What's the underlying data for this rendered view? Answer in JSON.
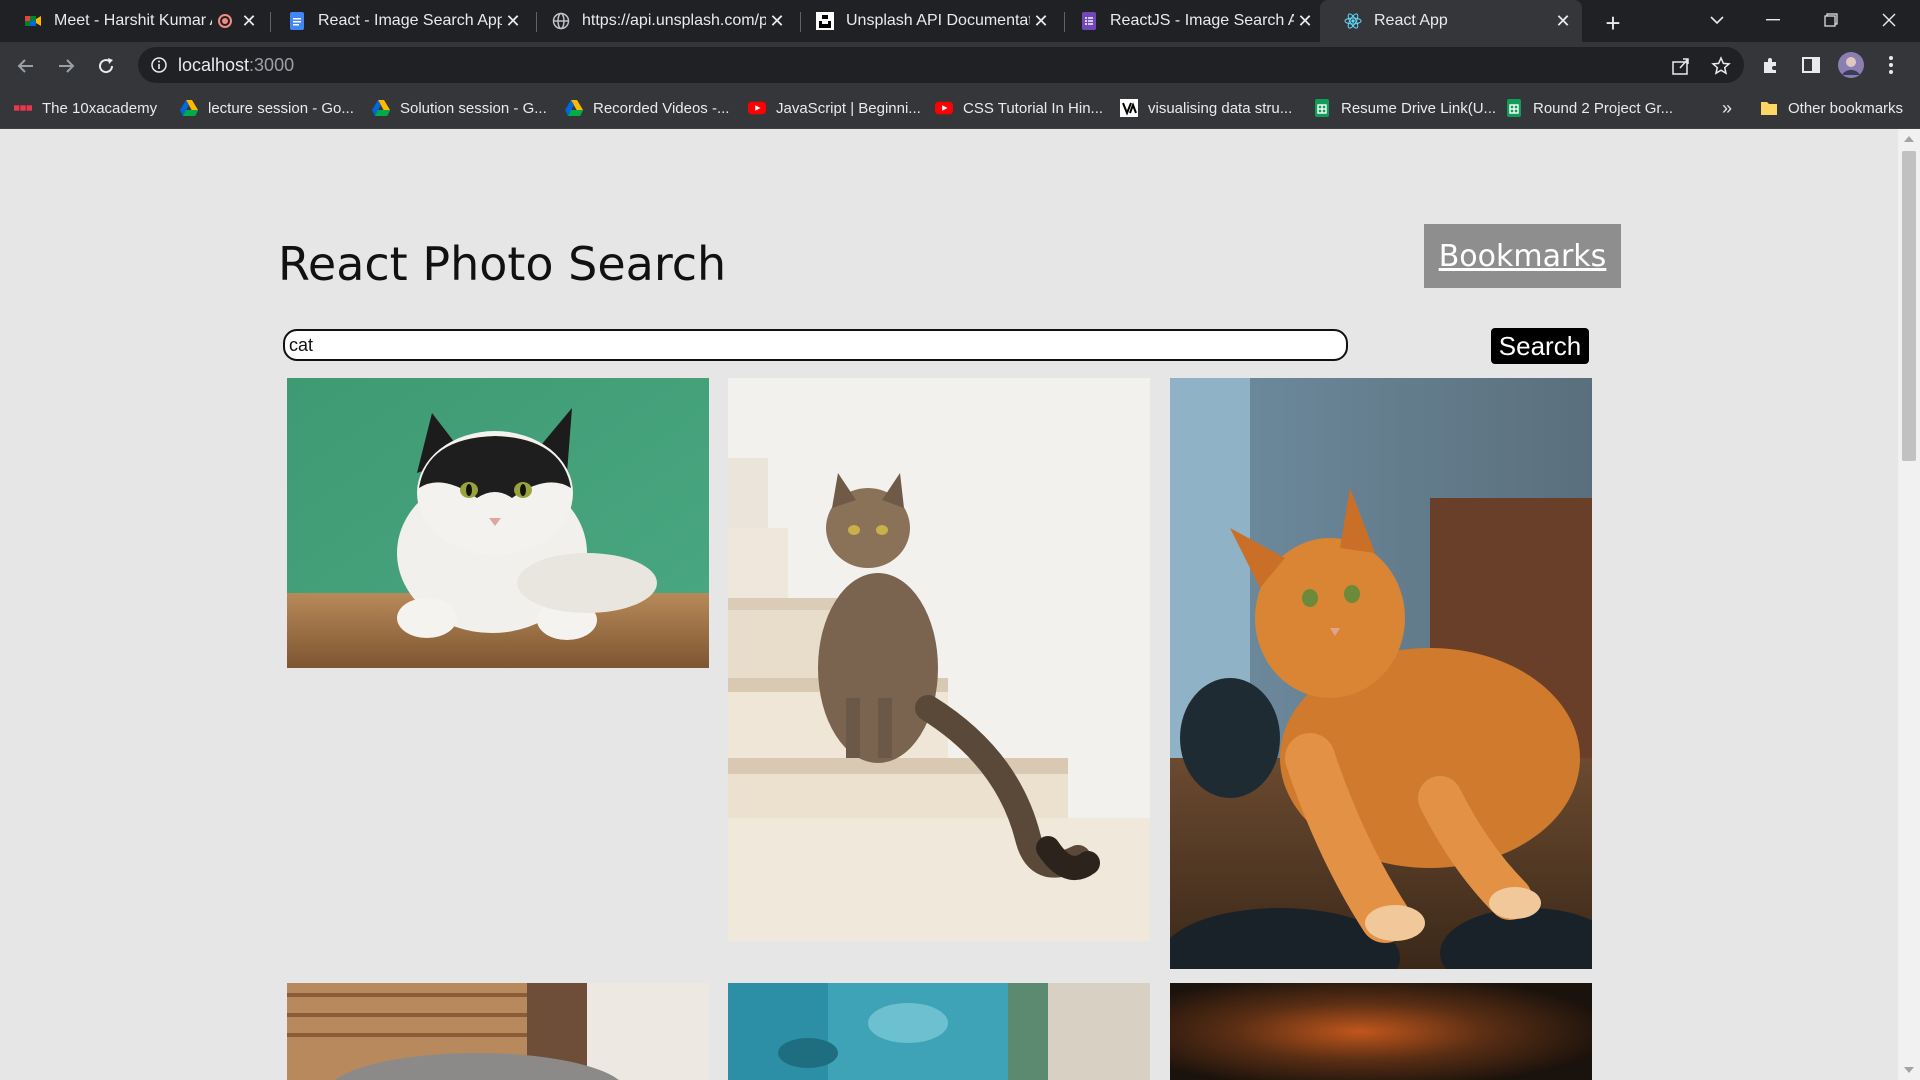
{
  "browser": {
    "tabs": [
      {
        "title": "Meet - Harshit Kumar A",
        "icon": "google-meet-icon",
        "recording": true
      },
      {
        "title": "React - Image Search App -",
        "icon": "google-docs-icon"
      },
      {
        "title": "https://api.unsplash.com/pl",
        "icon": "globe-icon"
      },
      {
        "title": "Unsplash API Documentatio",
        "icon": "unsplash-icon"
      },
      {
        "title": "ReactJS - Image Search App",
        "icon": "google-forms-icon"
      },
      {
        "title": "React App",
        "icon": "react-icon",
        "active": true
      }
    ],
    "address": {
      "host": "localhost",
      "port": ":3000"
    },
    "bookmarks": [
      {
        "label": "The 10xacademy",
        "icon": "academy-icon"
      },
      {
        "label": "lecture session - Go...",
        "icon": "google-drive-icon"
      },
      {
        "label": "Solution session - G...",
        "icon": "google-drive-icon"
      },
      {
        "label": "Recorded Videos -...",
        "icon": "google-drive-icon"
      },
      {
        "label": "JavaScript | Beginni...",
        "icon": "youtube-icon"
      },
      {
        "label": "CSS Tutorial In Hin...",
        "icon": "youtube-icon"
      },
      {
        "label": "visualising data stru...",
        "icon": "visualgo-icon"
      },
      {
        "label": "Resume Drive Link(U...",
        "icon": "google-sheets-icon"
      },
      {
        "label": "Round 2 Project Gr...",
        "icon": "google-sheets-icon"
      }
    ],
    "overflow_label": "»",
    "other_bookmarks": "Other bookmarks"
  },
  "app": {
    "title": "React Photo Search",
    "bookmarks_button": "Bookmarks",
    "search": {
      "value": "cat",
      "button": "Search"
    }
  },
  "photos": [
    {
      "subject": "black-and-white cat on green background"
    },
    {
      "subject": "tabby cat sitting on white stairs"
    },
    {
      "subject": "orange maine coon cat lying on wooden table"
    },
    {
      "subject": "grey cat under wicker basket"
    },
    {
      "subject": "teal textured wall"
    },
    {
      "subject": "dark blurred orange background"
    }
  ],
  "colors": {
    "page_bg": "#e6e6e6",
    "search_button_bg": "#000000",
    "bookmarks_button_bg": "#8e8e8e"
  }
}
